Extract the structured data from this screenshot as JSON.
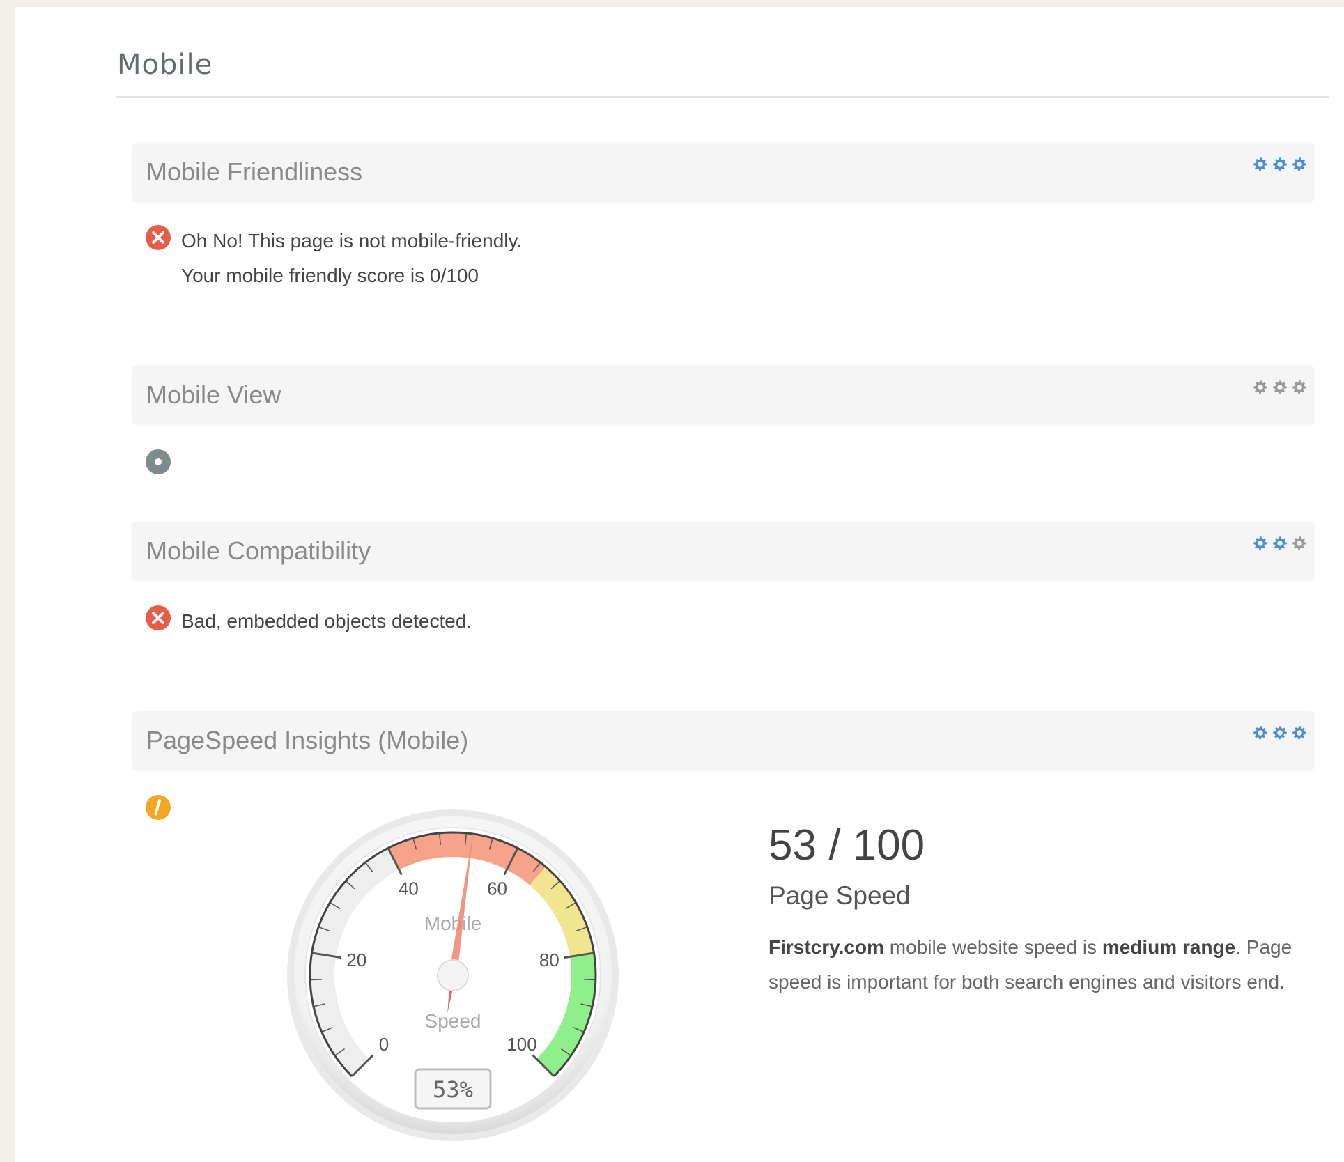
{
  "section": {
    "title": "Mobile"
  },
  "panels": [
    {
      "title": "Mobile Friendliness",
      "gears": [
        "gear-icon",
        "gear-icon",
        "gear-icon"
      ],
      "gear_colors": [
        "#4a8fd4",
        "#4a8fd4",
        "#4a8fd4"
      ],
      "status": "error",
      "lines": [
        "Oh No! This page is not mobile-friendly.",
        "Your mobile friendly score is 0/100"
      ]
    },
    {
      "title": "Mobile View",
      "gears": [
        "gear-icon",
        "gear-icon",
        "gear-icon"
      ],
      "gear_colors": [
        "#999999",
        "#999999",
        "#999999"
      ],
      "status": "neutral"
    },
    {
      "title": "Mobile Compatibility",
      "gears": [
        "gear-icon",
        "gear-icon",
        "gear-icon"
      ],
      "gear_colors": [
        "#4a8fd4",
        "#4a8fd4",
        "#999999"
      ],
      "status": "error",
      "lines": [
        "Bad, embedded objects detected."
      ]
    },
    {
      "title": "PageSpeed Insights (Mobile)",
      "gears": [
        "gear-icon",
        "gear-icon",
        "gear-icon"
      ],
      "gear_colors": [
        "#4a8fd4",
        "#4a8fd4",
        "#4a8fd4"
      ],
      "status": "warning"
    }
  ],
  "pagespeed": {
    "score_text": "53 / 100",
    "label": "Page Speed",
    "description": {
      "site": "Firstcry.com",
      "text1": " mobile website speed is ",
      "range": "medium range",
      "text2": ". Page speed is important for both search engines and visitors end."
    }
  },
  "gauge": {
    "value": 53,
    "min": 0,
    "max": 100,
    "ticks": [
      "0",
      "20",
      "40",
      "60",
      "80",
      "100"
    ],
    "title": "Mobile",
    "unit_label": "Speed",
    "readout": "53%",
    "bands": [
      {
        "from": 40,
        "to": 65,
        "color": "#f6a38a"
      },
      {
        "from": 65,
        "to": 80,
        "color": "#f1e58f"
      },
      {
        "from": 80,
        "to": 100,
        "color": "#8ff08b"
      }
    ]
  },
  "colors": {
    "error": "#e85c4a",
    "neutral": "#7e8a8b",
    "warning": "#f5a623",
    "gear_active": "#4a8fd4",
    "gear_inactive": "#999999"
  }
}
